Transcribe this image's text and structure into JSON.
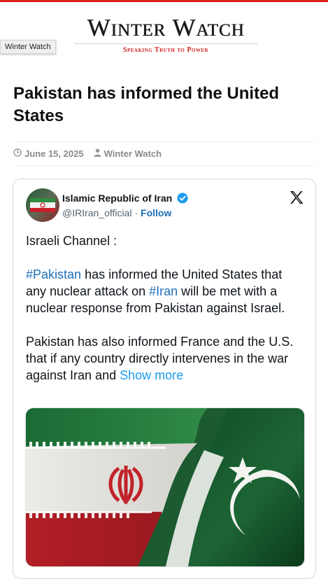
{
  "site": {
    "logo_title": "Winter Watch",
    "logo_tagline": "Speaking Truth to Power",
    "tooltip": "Winter Watch",
    "accent_color": "#e0201b"
  },
  "post": {
    "title": "Pakistan has informed the United States",
    "date": "June 15, 2025",
    "author": "Winter Watch"
  },
  "tweet": {
    "display_name": "Islamic Republic of Iran",
    "handle": "@IRIran_official",
    "separator": "·",
    "follow_label": "Follow",
    "line1": "Israeli Channel :",
    "p2_tag1": "#Pakistan",
    "p2_text1": " has informed the United States that any nuclear attack on ",
    "p2_tag2": "#Iran",
    "p2_text2": " will be met with a nuclear response from Pakistan against Israel.",
    "p3_text": "Pakistan has also informed France and the U.S. that if any country directly intervenes in the war against Iran and ",
    "show_more": "Show more",
    "link_color": "#1d9bf0",
    "media_alt_icons": [
      "iran-flag",
      "pakistan-flag"
    ]
  },
  "icons": {
    "date": "clock-icon",
    "author": "user-icon",
    "verified": "verified-badge-icon",
    "platform": "x-logo-icon"
  }
}
